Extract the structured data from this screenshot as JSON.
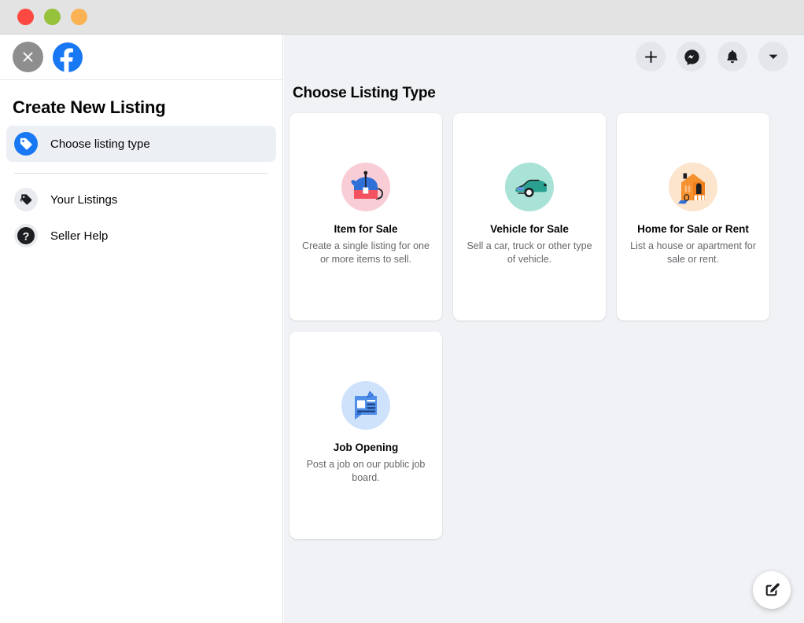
{
  "window": {
    "traffic_lights": [
      {
        "name": "close",
        "color": "#fc4a42"
      },
      {
        "name": "minimize",
        "color": "#96c13a"
      },
      {
        "name": "maximize",
        "color": "#fbb254"
      }
    ]
  },
  "sidebar": {
    "close_icon": "close-icon",
    "brand_icon": "facebook-logo",
    "title": "Create New Listing",
    "items": [
      {
        "label": "Choose listing type",
        "icon": "price-tag-icon",
        "selected": true
      },
      {
        "label": "Your Listings",
        "icon": "tags-icon",
        "selected": false
      },
      {
        "label": "Seller Help",
        "icon": "question-mark-icon",
        "selected": false
      }
    ]
  },
  "header": {
    "buttons": [
      {
        "name": "create-button",
        "icon": "plus-icon"
      },
      {
        "name": "messenger-button",
        "icon": "messenger-icon"
      },
      {
        "name": "notifications-button",
        "icon": "bell-icon"
      },
      {
        "name": "account-menu-button",
        "icon": "chevron-down-icon"
      }
    ]
  },
  "main": {
    "title": "Choose Listing Type",
    "cards": [
      {
        "title": "Item for Sale",
        "description": "Create a single listing for one or more items to sell.",
        "icon": "teapot-icon",
        "icon_bg": "#f9cdd6"
      },
      {
        "title": "Vehicle for Sale",
        "description": "Sell a car, truck or other type of vehicle.",
        "icon": "car-icon",
        "icon_bg": "#a9e3d7"
      },
      {
        "title": "Home for Sale or Rent",
        "description": "List a house or apartment for sale or rent.",
        "icon": "house-icon",
        "icon_bg": "#fce4cd"
      },
      {
        "title": "Job Opening",
        "description": "Post a job on our public job board.",
        "icon": "document-pencil-icon",
        "icon_bg": "#cfe2fb"
      }
    ]
  },
  "fab": {
    "name": "compose-button",
    "icon": "compose-icon"
  },
  "colors": {
    "brand_blue": "#1877f2",
    "page_bg": "#f0f2f5",
    "card_bg": "#ffffff",
    "text_primary": "#050505",
    "text_secondary": "#65676b"
  }
}
